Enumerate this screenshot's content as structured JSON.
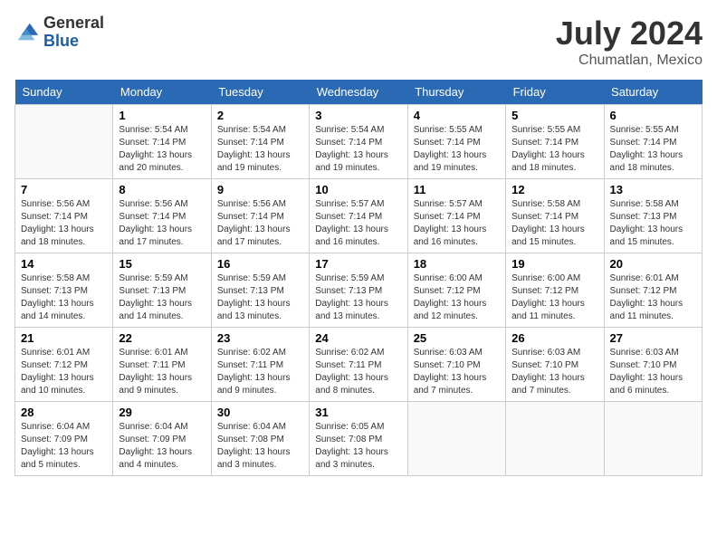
{
  "header": {
    "logo_general": "General",
    "logo_blue": "Blue",
    "month_title": "July 2024",
    "location": "Chumatlan, Mexico"
  },
  "calendar": {
    "days_of_week": [
      "Sunday",
      "Monday",
      "Tuesday",
      "Wednesday",
      "Thursday",
      "Friday",
      "Saturday"
    ],
    "weeks": [
      [
        {
          "day": "",
          "info": ""
        },
        {
          "day": "1",
          "info": "Sunrise: 5:54 AM\nSunset: 7:14 PM\nDaylight: 13 hours\nand 20 minutes."
        },
        {
          "day": "2",
          "info": "Sunrise: 5:54 AM\nSunset: 7:14 PM\nDaylight: 13 hours\nand 19 minutes."
        },
        {
          "day": "3",
          "info": "Sunrise: 5:54 AM\nSunset: 7:14 PM\nDaylight: 13 hours\nand 19 minutes."
        },
        {
          "day": "4",
          "info": "Sunrise: 5:55 AM\nSunset: 7:14 PM\nDaylight: 13 hours\nand 19 minutes."
        },
        {
          "day": "5",
          "info": "Sunrise: 5:55 AM\nSunset: 7:14 PM\nDaylight: 13 hours\nand 18 minutes."
        },
        {
          "day": "6",
          "info": "Sunrise: 5:55 AM\nSunset: 7:14 PM\nDaylight: 13 hours\nand 18 minutes."
        }
      ],
      [
        {
          "day": "7",
          "info": "Sunrise: 5:56 AM\nSunset: 7:14 PM\nDaylight: 13 hours\nand 18 minutes."
        },
        {
          "day": "8",
          "info": "Sunrise: 5:56 AM\nSunset: 7:14 PM\nDaylight: 13 hours\nand 17 minutes."
        },
        {
          "day": "9",
          "info": "Sunrise: 5:56 AM\nSunset: 7:14 PM\nDaylight: 13 hours\nand 17 minutes."
        },
        {
          "day": "10",
          "info": "Sunrise: 5:57 AM\nSunset: 7:14 PM\nDaylight: 13 hours\nand 16 minutes."
        },
        {
          "day": "11",
          "info": "Sunrise: 5:57 AM\nSunset: 7:14 PM\nDaylight: 13 hours\nand 16 minutes."
        },
        {
          "day": "12",
          "info": "Sunrise: 5:58 AM\nSunset: 7:14 PM\nDaylight: 13 hours\nand 15 minutes."
        },
        {
          "day": "13",
          "info": "Sunrise: 5:58 AM\nSunset: 7:13 PM\nDaylight: 13 hours\nand 15 minutes."
        }
      ],
      [
        {
          "day": "14",
          "info": "Sunrise: 5:58 AM\nSunset: 7:13 PM\nDaylight: 13 hours\nand 14 minutes."
        },
        {
          "day": "15",
          "info": "Sunrise: 5:59 AM\nSunset: 7:13 PM\nDaylight: 13 hours\nand 14 minutes."
        },
        {
          "day": "16",
          "info": "Sunrise: 5:59 AM\nSunset: 7:13 PM\nDaylight: 13 hours\nand 13 minutes."
        },
        {
          "day": "17",
          "info": "Sunrise: 5:59 AM\nSunset: 7:13 PM\nDaylight: 13 hours\nand 13 minutes."
        },
        {
          "day": "18",
          "info": "Sunrise: 6:00 AM\nSunset: 7:12 PM\nDaylight: 13 hours\nand 12 minutes."
        },
        {
          "day": "19",
          "info": "Sunrise: 6:00 AM\nSunset: 7:12 PM\nDaylight: 13 hours\nand 11 minutes."
        },
        {
          "day": "20",
          "info": "Sunrise: 6:01 AM\nSunset: 7:12 PM\nDaylight: 13 hours\nand 11 minutes."
        }
      ],
      [
        {
          "day": "21",
          "info": "Sunrise: 6:01 AM\nSunset: 7:12 PM\nDaylight: 13 hours\nand 10 minutes."
        },
        {
          "day": "22",
          "info": "Sunrise: 6:01 AM\nSunset: 7:11 PM\nDaylight: 13 hours\nand 9 minutes."
        },
        {
          "day": "23",
          "info": "Sunrise: 6:02 AM\nSunset: 7:11 PM\nDaylight: 13 hours\nand 9 minutes."
        },
        {
          "day": "24",
          "info": "Sunrise: 6:02 AM\nSunset: 7:11 PM\nDaylight: 13 hours\nand 8 minutes."
        },
        {
          "day": "25",
          "info": "Sunrise: 6:03 AM\nSunset: 7:10 PM\nDaylight: 13 hours\nand 7 minutes."
        },
        {
          "day": "26",
          "info": "Sunrise: 6:03 AM\nSunset: 7:10 PM\nDaylight: 13 hours\nand 7 minutes."
        },
        {
          "day": "27",
          "info": "Sunrise: 6:03 AM\nSunset: 7:10 PM\nDaylight: 13 hours\nand 6 minutes."
        }
      ],
      [
        {
          "day": "28",
          "info": "Sunrise: 6:04 AM\nSunset: 7:09 PM\nDaylight: 13 hours\nand 5 minutes."
        },
        {
          "day": "29",
          "info": "Sunrise: 6:04 AM\nSunset: 7:09 PM\nDaylight: 13 hours\nand 4 minutes."
        },
        {
          "day": "30",
          "info": "Sunrise: 6:04 AM\nSunset: 7:08 PM\nDaylight: 13 hours\nand 3 minutes."
        },
        {
          "day": "31",
          "info": "Sunrise: 6:05 AM\nSunset: 7:08 PM\nDaylight: 13 hours\nand 3 minutes."
        },
        {
          "day": "",
          "info": ""
        },
        {
          "day": "",
          "info": ""
        },
        {
          "day": "",
          "info": ""
        }
      ]
    ]
  }
}
